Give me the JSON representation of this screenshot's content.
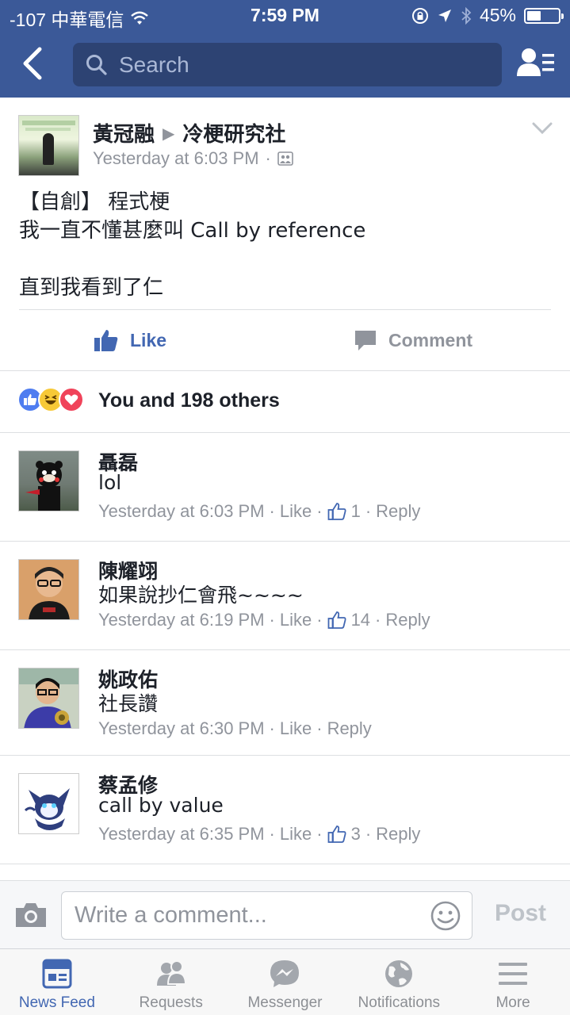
{
  "status_bar": {
    "carrier": "-107 中華電信",
    "time": "7:59 PM",
    "battery": "45%",
    "battery_level": 0.45
  },
  "nav": {
    "search_placeholder": "Search"
  },
  "post": {
    "author": "黃冠融",
    "group": "冷梗研究社",
    "time": "Yesterday at 6:03 PM",
    "time_separator": "·",
    "lines": [
      "【自創】 程式梗",
      "我一直不懂甚麼叫 Call by reference",
      "",
      "直到我看到了仁"
    ],
    "like_label": "Like",
    "comment_label": "Comment",
    "reactions_text": "You and 198 others"
  },
  "comments": [
    {
      "name": "聶磊",
      "text": "lol",
      "time": "Yesterday at 6:03 PM",
      "like": "Like",
      "likes": "1",
      "reply": "Reply"
    },
    {
      "name": "陳耀翊",
      "text": "如果說抄仁會飛~~~~",
      "time": "Yesterday at 6:19 PM",
      "like": "Like",
      "likes": "14",
      "reply": "Reply"
    },
    {
      "name": "姚政佑",
      "text": "社長讚",
      "time": "Yesterday at 6:30 PM",
      "like": "Like",
      "likes": "",
      "reply": "Reply"
    },
    {
      "name": "蔡孟修",
      "text": "call by value",
      "time": "Yesterday at 6:35 PM",
      "like": "Like",
      "likes": "3",
      "reply": "Reply"
    }
  ],
  "composer": {
    "placeholder": "Write a comment...",
    "post_label": "Post"
  },
  "tabs": [
    {
      "label": "News Feed",
      "icon": "news-feed-icon",
      "active": true
    },
    {
      "label": "Requests",
      "icon": "requests-icon",
      "active": false
    },
    {
      "label": "Messenger",
      "icon": "messenger-icon",
      "active": false
    },
    {
      "label": "Notifications",
      "icon": "notifications-icon",
      "active": false
    },
    {
      "label": "More",
      "icon": "more-icon",
      "active": false
    }
  ],
  "colors": {
    "brand_blue": "#3b5998",
    "link_blue": "#4267b2",
    "meta_gray": "#90949c"
  }
}
